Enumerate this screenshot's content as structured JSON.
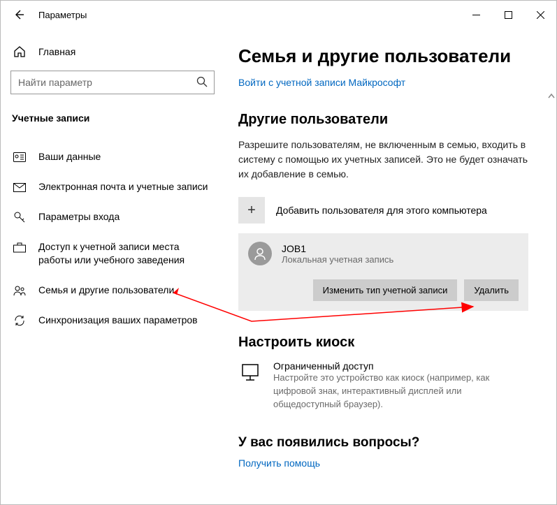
{
  "titlebar": {
    "title": "Параметры"
  },
  "sidebar": {
    "home": "Главная",
    "search_placeholder": "Найти параметр",
    "category": "Учетные записи",
    "items": [
      {
        "label": "Ваши данные"
      },
      {
        "label": "Электронная почта и учетные записи"
      },
      {
        "label": "Параметры входа"
      },
      {
        "label": "Доступ к учетной записи места работы или учебного заведения"
      },
      {
        "label": "Семья и другие пользователи"
      },
      {
        "label": "Синхронизация ваших параметров"
      }
    ]
  },
  "main": {
    "heading": "Семья и другие пользователи",
    "signin_link": "Войти с учетной записи Майкрософт",
    "other_users_h": "Другие пользователи",
    "other_users_p": "Разрешите пользователям, не включенным в семью, входить в систему с помощью их учетных записей. Это не будет означать их добавление в семью.",
    "add_user": "Добавить пользователя для этого компьютера",
    "user": {
      "name": "JOB1",
      "sub": "Локальная учетная запись",
      "change_btn": "Изменить тип учетной записи",
      "delete_btn": "Удалить"
    },
    "kiosk_h": "Настроить киоск",
    "kiosk": {
      "title": "Ограниченный доступ",
      "sub": "Настройте это устройство как киоск (например, как цифровой знак, интерактивный дисплей или общедоступный браузер)."
    },
    "questions_h": "У вас появились вопросы?",
    "help_link": "Получить помощь"
  }
}
